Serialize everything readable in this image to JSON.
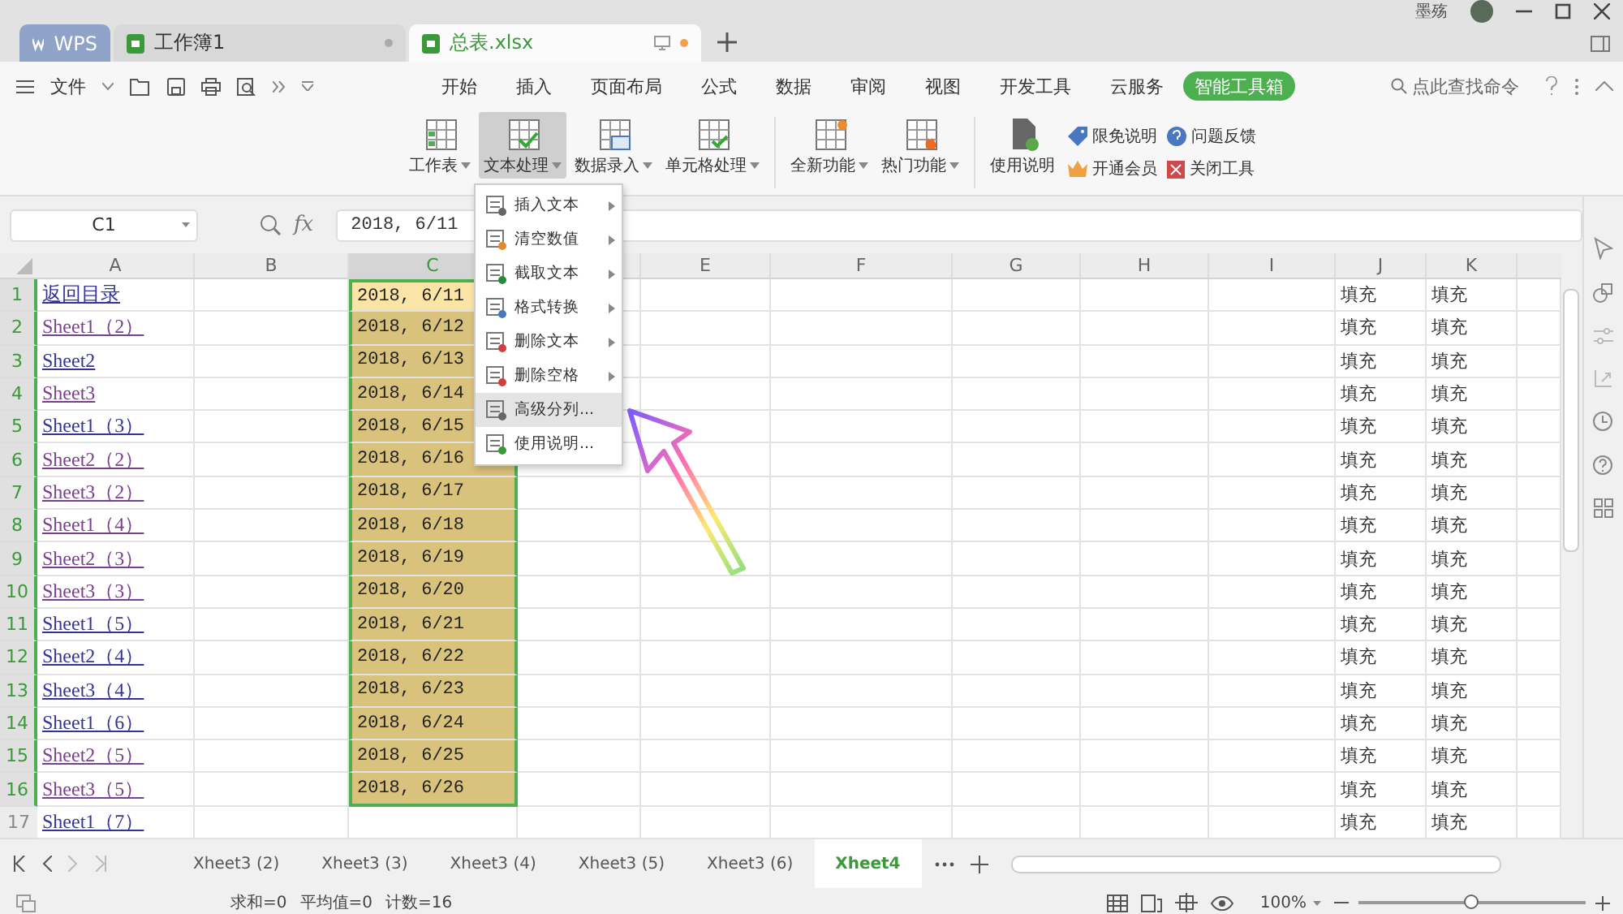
{
  "title_bar": {
    "tabs": [
      {
        "label": "WPS",
        "kind": "brand",
        "selected": false
      },
      {
        "label": "工作簿1",
        "kind": "doc",
        "selected": false
      },
      {
        "label": "总表.xlsx",
        "kind": "doc",
        "selected": true
      }
    ],
    "user": "墨殇"
  },
  "file_menu": {
    "label": "文件"
  },
  "menu_tabs": [
    {
      "label": "开始",
      "selected": false
    },
    {
      "label": "插入",
      "selected": false
    },
    {
      "label": "页面布局",
      "selected": false
    },
    {
      "label": "公式",
      "selected": false
    },
    {
      "label": "数据",
      "selected": false
    },
    {
      "label": "审阅",
      "selected": false
    },
    {
      "label": "视图",
      "selected": false
    },
    {
      "label": "开发工具",
      "selected": false
    },
    {
      "label": "云服务",
      "selected": false
    },
    {
      "label": "智能工具箱",
      "selected": true
    }
  ],
  "search": {
    "placeholder": "点此查找命令"
  },
  "ribbon": {
    "large_buttons": [
      {
        "label": "工作表",
        "dropdown": true,
        "selected": false
      },
      {
        "label": "文本处理",
        "dropdown": true,
        "selected": true
      },
      {
        "label": "数据录入",
        "dropdown": true,
        "selected": false
      },
      {
        "label": "单元格处理",
        "dropdown": true,
        "selected": false
      },
      {
        "label": "全新功能",
        "dropdown": true,
        "selected": false
      },
      {
        "label": "热门功能",
        "dropdown": true,
        "selected": false
      },
      {
        "label": "使用说明",
        "dropdown": false,
        "selected": false
      }
    ],
    "small_buttons": [
      {
        "label": "限免说明"
      },
      {
        "label": "问题反馈"
      },
      {
        "label": "开通会员"
      },
      {
        "label": "关闭工具"
      }
    ]
  },
  "dropdown_menu": {
    "items": [
      {
        "label": "插入文本",
        "submenu": true,
        "selected": false
      },
      {
        "label": "清空数值",
        "submenu": true,
        "selected": false
      },
      {
        "label": "截取文本",
        "submenu": true,
        "selected": false
      },
      {
        "label": "格式转换",
        "submenu": true,
        "selected": false
      },
      {
        "label": "删除文本",
        "submenu": true,
        "selected": false
      },
      {
        "label": "删除空格",
        "submenu": true,
        "selected": false
      },
      {
        "label": "高级分列...",
        "submenu": false,
        "selected": true
      },
      {
        "label": "使用说明...",
        "submenu": false,
        "selected": false
      }
    ]
  },
  "formula_bar": {
    "name_box": "C1",
    "fx_label": "fx",
    "formula": "2018, 6/11"
  },
  "sheet": {
    "columns": [
      {
        "label": "A",
        "selected": false
      },
      {
        "label": "B",
        "selected": false
      },
      {
        "label": "C",
        "selected": true
      },
      {
        "selected": false
      },
      {
        "label": "E",
        "selected": false
      },
      {
        "label": "F",
        "selected": false
      },
      {
        "label": "G",
        "selected": false
      },
      {
        "label": "H",
        "selected": false
      },
      {
        "label": "I",
        "selected": false
      },
      {
        "label": "J",
        "selected": false
      },
      {
        "label": "K",
        "selected": false
      }
    ],
    "rows": [
      {
        "number": "1",
        "a": {
          "text": "返回目录",
          "visited": false
        },
        "c": {
          "text": "2018, 6/11",
          "selected": true,
          "active": true
        },
        "j": "填充",
        "k": "填充"
      },
      {
        "number": "2",
        "a": {
          "text": "Sheet1（2）",
          "visited": true
        },
        "c": {
          "text": "2018, 6/12",
          "selected": true,
          "active": false
        },
        "j": "填充",
        "k": "填充"
      },
      {
        "number": "3",
        "a": {
          "text": "Sheet2",
          "visited": false
        },
        "c": {
          "text": "2018, 6/13",
          "selected": true,
          "active": false
        },
        "j": "填充",
        "k": "填充"
      },
      {
        "number": "4",
        "a": {
          "text": "Sheet3",
          "visited": true
        },
        "c": {
          "text": "2018, 6/14",
          "selected": true,
          "active": false
        },
        "j": "填充",
        "k": "填充"
      },
      {
        "number": "5",
        "a": {
          "text": "Sheet1（3）",
          "visited": false
        },
        "c": {
          "text": "2018, 6/15",
          "selected": true,
          "active": false
        },
        "j": "填充",
        "k": "填充"
      },
      {
        "number": "6",
        "a": {
          "text": "Sheet2（2）",
          "visited": true
        },
        "c": {
          "text": "2018, 6/16",
          "selected": true,
          "active": false
        },
        "j": "填充",
        "k": "填充"
      },
      {
        "number": "7",
        "a": {
          "text": "Sheet3（2）",
          "visited": true
        },
        "c": {
          "text": "2018, 6/17",
          "selected": true,
          "active": false
        },
        "j": "填充",
        "k": "填充"
      },
      {
        "number": "8",
        "a": {
          "text": "Sheet1（4）",
          "visited": true
        },
        "c": {
          "text": "2018, 6/18",
          "selected": true,
          "active": false
        },
        "j": "填充",
        "k": "填充"
      },
      {
        "number": "9",
        "a": {
          "text": "Sheet2（3）",
          "visited": true
        },
        "c": {
          "text": "2018, 6/19",
          "selected": true,
          "active": false
        },
        "j": "填充",
        "k": "填充"
      },
      {
        "number": "10",
        "a": {
          "text": "Sheet3（3）",
          "visited": true
        },
        "c": {
          "text": "2018, 6/20",
          "selected": true,
          "active": false
        },
        "j": "填充",
        "k": "填充"
      },
      {
        "number": "11",
        "a": {
          "text": "Sheet1（5）",
          "visited": false
        },
        "c": {
          "text": "2018, 6/21",
          "selected": true,
          "active": false
        },
        "j": "填充",
        "k": "填充"
      },
      {
        "number": "12",
        "a": {
          "text": "Sheet2（4）",
          "visited": false
        },
        "c": {
          "text": "2018, 6/22",
          "selected": true,
          "active": false
        },
        "j": "填充",
        "k": "填充"
      },
      {
        "number": "13",
        "a": {
          "text": "Sheet3（4）",
          "visited": false
        },
        "c": {
          "text": "2018, 6/23",
          "selected": true,
          "active": false
        },
        "j": "填充",
        "k": "填充"
      },
      {
        "number": "14",
        "a": {
          "text": "Sheet1（6）",
          "visited": false
        },
        "c": {
          "text": "2018, 6/24",
          "selected": true,
          "active": false
        },
        "j": "填充",
        "k": "填充"
      },
      {
        "number": "15",
        "a": {
          "text": "Sheet2（5）",
          "visited": true
        },
        "c": {
          "text": "2018, 6/25",
          "selected": true,
          "active": false
        },
        "j": "填充",
        "k": "填充"
      },
      {
        "number": "16",
        "a": {
          "text": "Sheet3（5）",
          "visited": true
        },
        "c": {
          "text": "2018, 6/26",
          "selected": true,
          "active": false
        },
        "j": "填充",
        "k": "填充"
      },
      {
        "number": "17",
        "a": {
          "text": "Sheet1（7）",
          "visited": false
        },
        "j": "填充",
        "k": "填充"
      }
    ]
  },
  "sheet_tabs": [
    {
      "label": "Xheet3 (2)",
      "selected": false
    },
    {
      "label": "Xheet3 (3)",
      "selected": false
    },
    {
      "label": "Xheet3 (4)",
      "selected": false
    },
    {
      "label": "Xheet3 (5)",
      "selected": false
    },
    {
      "label": "Xheet3 (6)",
      "selected": false
    },
    {
      "label": "Xheet4",
      "selected": true
    }
  ],
  "status_bar": {
    "stats": [
      "求和=0",
      "平均值=0",
      "计数=16"
    ],
    "zoom": "100%",
    "zoom_slider": {
      "level": 0.5
    }
  }
}
